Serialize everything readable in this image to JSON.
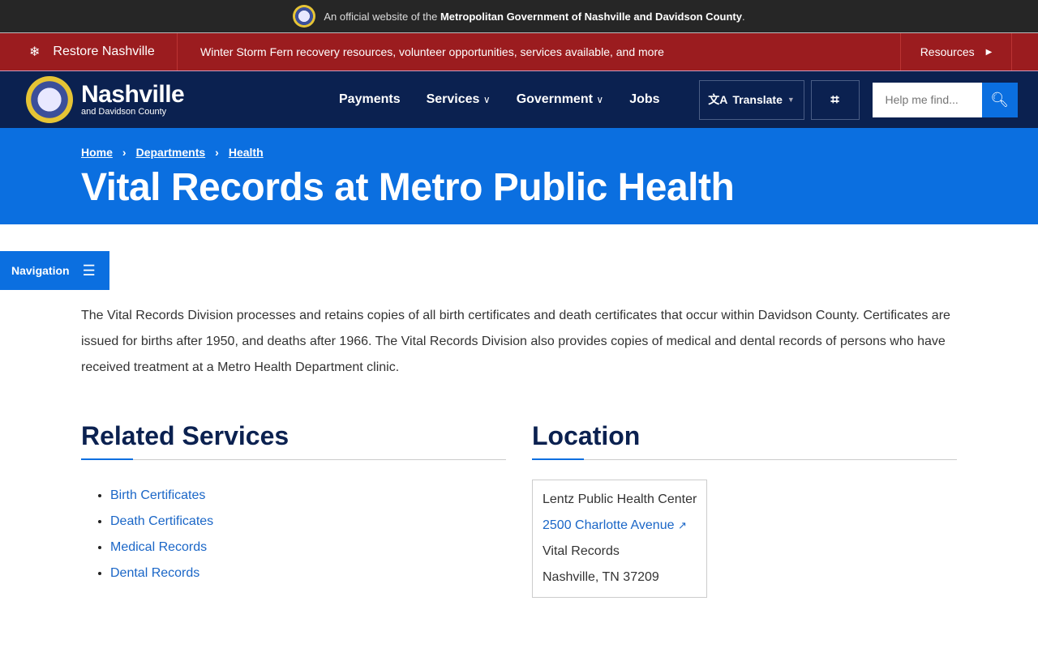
{
  "banner": {
    "prefix": "An official website of the",
    "org": "Metropolitan Government of Nashville and Davidson County",
    "suffix": "."
  },
  "alert": {
    "title": "Restore Nashville",
    "message": "Winter Storm Fern recovery resources, volunteer opportunities, services available, and more",
    "resources": "Resources"
  },
  "header": {
    "name": "Nashville",
    "sub": "and Davidson County",
    "menu": [
      "Payments",
      "Services",
      "Government",
      "Jobs"
    ],
    "translate": "Translate",
    "search_placeholder": "Help me find..."
  },
  "breadcrumb": [
    "Home",
    "Departments",
    "Health"
  ],
  "title": "Vital Records at Metro Public Health",
  "nav_button": "Navigation",
  "intro": "The Vital Records Division processes and retains copies of all birth certificates and death certificates that occur within Davidson County. Certificates are issued for births after 1950, and deaths after 1966. The Vital Records Division also provides copies of medical and dental records of persons who have received treatment at a Metro Health Department clinic.",
  "related": {
    "heading": "Related Services",
    "items": [
      "Birth Certificates",
      "Death Certificates",
      "Medical Records",
      "Dental Records"
    ]
  },
  "location": {
    "heading": "Location",
    "name": "Lentz Public Health Center",
    "address": "2500 Charlotte Avenue",
    "dept": "Vital Records",
    "city": "Nashville, TN 37209"
  }
}
